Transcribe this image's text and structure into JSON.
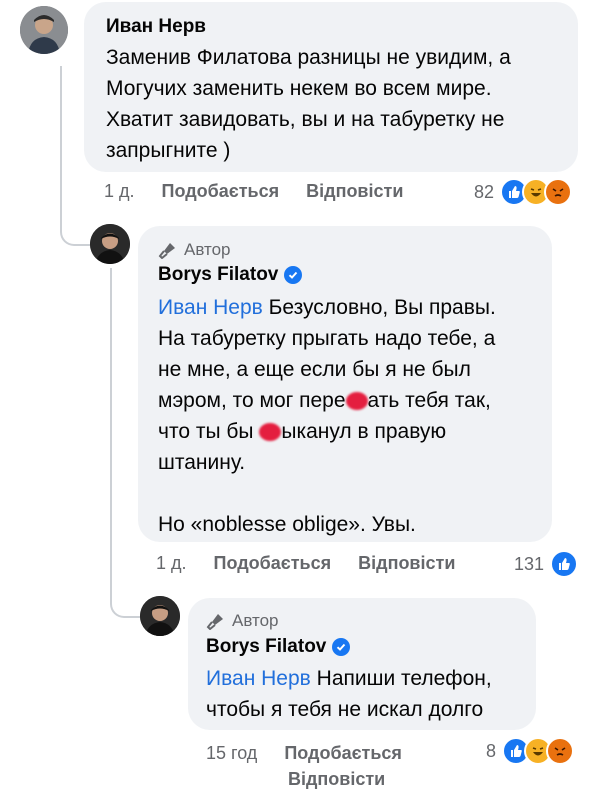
{
  "comment1": {
    "author": "Иван Нерв",
    "lines": [
      "Заменив Филатова разницы не увидим, а",
      "Могучих заменить некем во всем мире.",
      "Хватит завидовать, вы и на табуретку не",
      "запрыгните )"
    ],
    "time": "1 д.",
    "like_label": "Подобається",
    "reply_label": "Відповісти",
    "reaction_count": "82",
    "reactions": [
      "like-icon",
      "haha-icon",
      "angry-icon"
    ]
  },
  "reply1": {
    "badge": "Автор",
    "author": "Borys Filatov",
    "mention": "Иван Нерв",
    "line1_rest": " Безусловно, Вы правы.",
    "line2": "На табуретку прыгать надо тебе, а",
    "line3": "не мне, а еще если бы я не был",
    "line4_a": "мэром, то мог пере",
    "line4_b": "ать тебя так,",
    "line5_a": "что ты бы ",
    "line5_b": "ыканул в правую",
    "line6": "штанину.",
    "line7": "Но «noblesse oblige». Увы.",
    "time": "1 д.",
    "like_label": "Подобається",
    "reply_label": "Відповісти",
    "reaction_count": "131",
    "reactions": [
      "like-icon"
    ]
  },
  "reply2": {
    "badge": "Автор",
    "author": "Borys Filatov",
    "mention": "Иван Нерв",
    "line1_rest": " Напиши телефон,",
    "line2": "чтобы я тебя не искал долго",
    "time": "15 год",
    "like_label": "Подобається",
    "reply_label": "Відповісти",
    "reaction_count": "8",
    "reactions": [
      "like-icon",
      "haha-icon",
      "angry-icon"
    ]
  },
  "colors": {
    "bubble": "#f0f2f5",
    "mention": "#216fdb",
    "like": "#1877f2",
    "meta": "#65676b"
  }
}
